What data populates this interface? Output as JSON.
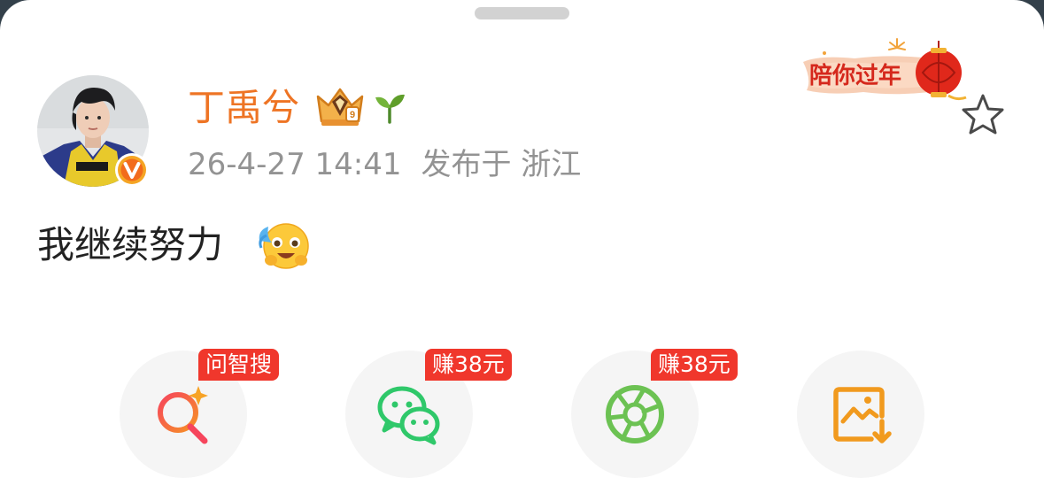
{
  "post": {
    "username": "丁禹兮",
    "timestamp": "26-4-27 14:41",
    "location_text": "发布于 浙江",
    "content": "我继续努力"
  },
  "banner": {
    "text": "陪你过年"
  },
  "share_actions": [
    {
      "icon": "ai-search-icon",
      "tag": "问智搜"
    },
    {
      "icon": "wechat-icon",
      "tag": "赚38元"
    },
    {
      "icon": "moments-icon",
      "tag": "赚38元"
    },
    {
      "icon": "save-image-icon",
      "tag": ""
    }
  ],
  "colors": {
    "username": "#ee7424",
    "tag_bg": "#f0372c",
    "wechat": "#2fc86a",
    "moments": "#6cc253",
    "save": "#f19a1e",
    "search_grad_start": "#f6455c",
    "search_grad_end": "#f69226"
  }
}
